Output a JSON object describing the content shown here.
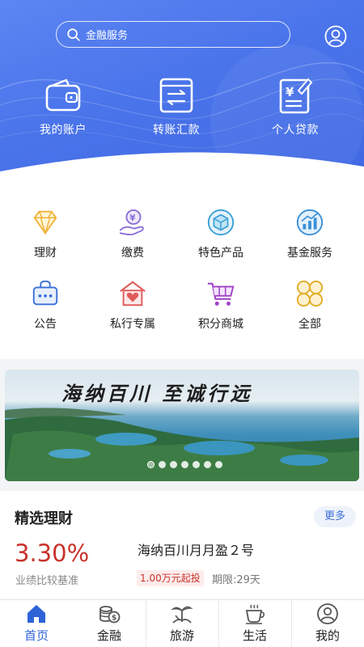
{
  "search": {
    "placeholder": "金融服务"
  },
  "quick_actions": [
    {
      "label": "我的账户",
      "icon": "wallet-icon"
    },
    {
      "label": "转账汇款",
      "icon": "transfer-icon"
    },
    {
      "label": "个人贷款",
      "icon": "loan-document-icon"
    }
  ],
  "services": [
    {
      "label": "理财",
      "icon": "diamond-icon"
    },
    {
      "label": "缴费",
      "icon": "payment-hand-icon"
    },
    {
      "label": "特色产品",
      "icon": "cube-icon"
    },
    {
      "label": "基金服务",
      "icon": "fund-chart-icon"
    },
    {
      "label": "公告",
      "icon": "notice-bag-icon"
    },
    {
      "label": "私行专属",
      "icon": "private-house-icon"
    },
    {
      "label": "积分商城",
      "icon": "shopping-cart-icon"
    },
    {
      "label": "全部",
      "icon": "grid-all-icon"
    }
  ],
  "banner": {
    "slogan": "海纳百川  至诚行远",
    "dot_count": 7,
    "active_dot": 0
  },
  "featured": {
    "title": "精选理财",
    "more_label": "更多",
    "rate": "3.30%",
    "rate_label": "业绩比较基准",
    "product_name": "海纳百川月月盈２号",
    "min_purchase": "1.00万元起投",
    "period": "期限:29天"
  },
  "tabs": [
    {
      "label": "首页",
      "icon": "home-icon",
      "active": true
    },
    {
      "label": "金融",
      "icon": "coins-icon",
      "active": false
    },
    {
      "label": "旅游",
      "icon": "travel-icon",
      "active": false
    },
    {
      "label": "生活",
      "icon": "coffee-cup-icon",
      "active": false
    },
    {
      "label": "我的",
      "icon": "profile-icon",
      "active": false
    }
  ],
  "colors": {
    "primary": "#4a74ea",
    "accent_red": "#c8322a",
    "active_tab": "#2e63d8"
  }
}
